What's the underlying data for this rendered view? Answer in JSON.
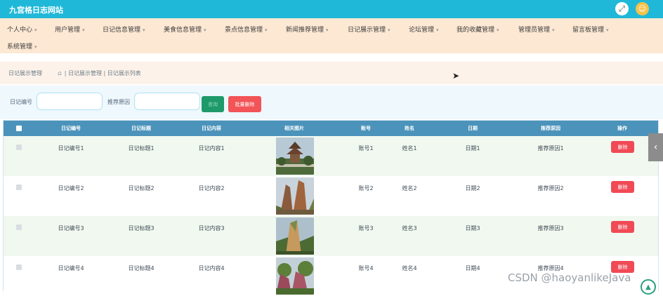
{
  "header": {
    "site_title": "九宫格日志网站",
    "fullscreen_icon": "expand-icon",
    "user_icon": "user-avatar-icon"
  },
  "menu": [
    {
      "label": "个人中心",
      "has_caret": true
    },
    {
      "label": "用户管理",
      "has_caret": true
    },
    {
      "label": "日记信息管理",
      "has_caret": true
    },
    {
      "label": "美食信息管理",
      "has_caret": true
    },
    {
      "label": "景点信息管理",
      "has_caret": true
    },
    {
      "label": "新闻推荐管理",
      "has_caret": true
    },
    {
      "label": "日记展示管理",
      "has_caret": true
    },
    {
      "label": "论坛管理",
      "has_caret": true
    },
    {
      "label": "我的收藏管理",
      "has_caret": true
    },
    {
      "label": "管理员管理",
      "has_caret": true
    },
    {
      "label": "留言板管理",
      "has_caret": true
    },
    {
      "label": "系统管理",
      "has_caret": true
    }
  ],
  "breadcrumb": {
    "root": "日记展示管理",
    "items": [
      "日记展示管理",
      "日记展示列表"
    ],
    "home_icon": "home-icon"
  },
  "search": {
    "field1_label": "日记编号",
    "field1_value": "",
    "field2_label": "推荐原因",
    "field2_value": "",
    "search_button": "查询",
    "batch_delete_button": "批量删除"
  },
  "table": {
    "columns": [
      "日记编号",
      "日记标题",
      "日记内容",
      "相关图片",
      "账号",
      "姓名",
      "日期",
      "推荐原因",
      "操作"
    ],
    "rows": [
      {
        "id": "日记编号1",
        "title": "日记标题1",
        "content": "日记内容1",
        "account": "账号1",
        "name": "姓名1",
        "date": "日期1",
        "reason": "推荐原因1",
        "action": "删除"
      },
      {
        "id": "日记编号2",
        "title": "日记标题2",
        "content": "日记内容2",
        "account": "账号2",
        "name": "姓名2",
        "date": "日期2",
        "reason": "推荐原因2",
        "action": "删除"
      },
      {
        "id": "日记编号3",
        "title": "日记标题3",
        "content": "日记内容3",
        "account": "账号3",
        "name": "姓名3",
        "date": "日期3",
        "reason": "推荐原因3",
        "action": "删除"
      },
      {
        "id": "日记编号4",
        "title": "日记标题4",
        "content": "日记内容4",
        "account": "账号4",
        "name": "姓名4",
        "date": "日期4",
        "reason": "推荐原因4",
        "action": "删除"
      }
    ]
  },
  "colors": {
    "topbar": "#1fb8d8",
    "menubar": "#fde8d3",
    "table_header": "#4b93ba",
    "delete_red": "#f04a56",
    "search_green": "#1e9a6a"
  },
  "watermark": "CSDN @haoyanlikeJava"
}
